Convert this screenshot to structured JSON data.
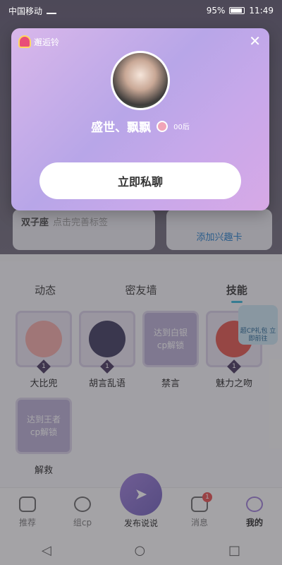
{
  "status": {
    "carrier": "中国移动",
    "battery": "95%",
    "time": "11:49"
  },
  "background": {
    "constellation": "双子座",
    "complete_tags": "点击完善标签",
    "add_interest": "添加兴趣卡"
  },
  "tabs": [
    {
      "label": "动态"
    },
    {
      "label": "密友墙"
    },
    {
      "label": "技能"
    }
  ],
  "skills": [
    {
      "name": "大比兜",
      "level": "1",
      "lock_text": ""
    },
    {
      "name": "胡言乱语",
      "level": "1",
      "lock_text": ""
    },
    {
      "name": "禁言",
      "level": "",
      "lock_text": "达到白银cp解锁"
    },
    {
      "name": "魅力之吻",
      "level": "1",
      "lock_text": ""
    },
    {
      "name": "解救",
      "level": "",
      "lock_text": "达到王者cp解锁"
    }
  ],
  "floater": {
    "text": "超CP礼包 立即前往"
  },
  "bottom_nav": {
    "recommend": "推荐",
    "group_cp": "组cp",
    "publish": "发布说说",
    "messages": "消息",
    "messages_badge": "1",
    "mine": "我的"
  },
  "modal": {
    "title": "邂逅铃",
    "username": "盛世、飘飘",
    "age_tag": "00后",
    "chat_button": "立即私聊"
  }
}
